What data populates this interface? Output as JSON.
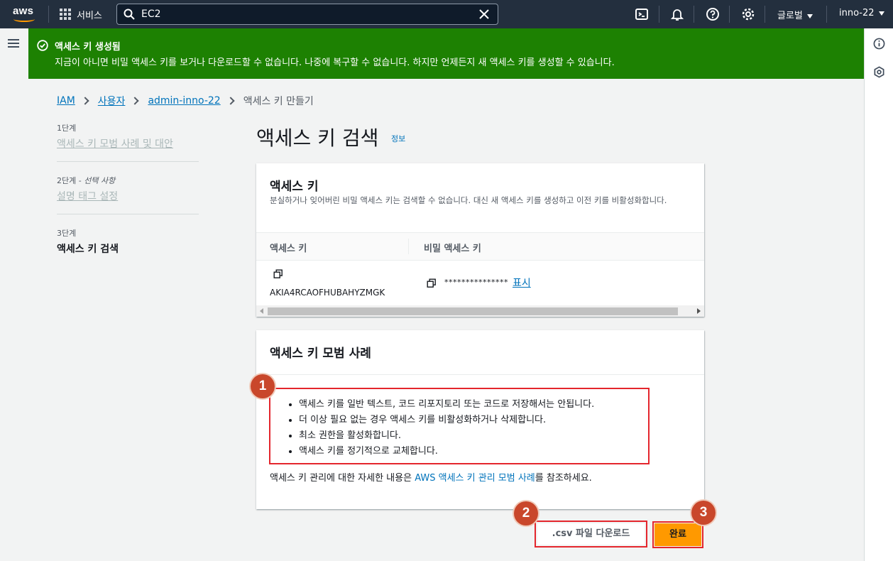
{
  "nav": {
    "logo_text": "aws",
    "services_label": "서비스",
    "search_value": "EC2",
    "region_label": "글로벌",
    "account_label": "inno-22"
  },
  "flash": {
    "title": "액세스 키 생성됨",
    "message": "지금이 아니면 비밀 액세스 키를 보거나 다운로드할 수 없습니다. 나중에 복구할 수 없습니다. 하지만 언제든지 새 액세스 키를 생성할 수 있습니다.",
    "color": "#1d8102"
  },
  "breadcrumb": [
    {
      "label": "IAM"
    },
    {
      "label": "사용자"
    },
    {
      "label": "admin-inno-22"
    },
    {
      "label": "액세스 키 만들기"
    }
  ],
  "steps": [
    {
      "step": "1단계",
      "label": "액세스 키 모범 사례 및 대안"
    },
    {
      "step": "2단계",
      "optional": "선택 사항",
      "label": "설명 태그 설정"
    },
    {
      "step": "3단계",
      "label": "액세스 키 검색"
    }
  ],
  "page": {
    "title": "액세스 키 검색",
    "info_link": "정보"
  },
  "access_key_card": {
    "title": "액세스 키",
    "description": "분실하거나 잊어버린 비밀 액세스 키는 검색할 수 없습니다. 대신 새 액세스 키를 생성하고 이전 키를 비활성화합니다.",
    "columns": [
      "액세스 키",
      "비밀 액세스 키"
    ],
    "access_key_id": "AKIA4RCAOFHUBAHYZMGK",
    "secret_masked": "***************",
    "show_label": "표시"
  },
  "best_practices_card": {
    "title": "액세스 키 모범 사례",
    "items": [
      "액세스 키를 일반 텍스트, 코드 리포지토리 또는 코드로 저장해서는 안됩니다.",
      "더 이상 필요 없는 경우 액세스 키를 비활성화하거나 삭제합니다.",
      "최소 권한을 활성화합니다.",
      "액세스 키를 정기적으로 교체합니다."
    ],
    "more_prefix": "액세스 키 관리에 대한 자세한 내용은 ",
    "more_link": "AWS 액세스 키 관리 모범 사례",
    "more_suffix": "를 참조하세요."
  },
  "actions": {
    "csv_label": ".csv 파일 다운로드",
    "done_label": "완료",
    "accent": "#ff9900"
  },
  "annotations": {
    "badge1": "1",
    "badge2": "2",
    "badge3": "3",
    "color": "#e4262d"
  }
}
